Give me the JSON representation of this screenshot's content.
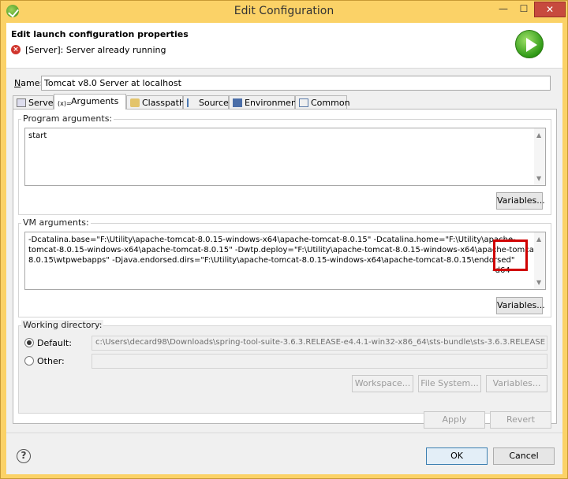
{
  "window": {
    "title": "Edit Configuration",
    "controls": {
      "minimize": "—",
      "maximize": "☐",
      "close": "✕"
    }
  },
  "header": {
    "title": "Edit launch configuration properties",
    "message": "[Server]: Server already running",
    "error_icon": "error-icon",
    "run_icon": "run-icon"
  },
  "name_field": {
    "label": "Name:",
    "value": "Tomcat v8.0 Server at localhost"
  },
  "tabs": [
    {
      "label": "Server",
      "icon": "server-icon"
    },
    {
      "label": "Arguments",
      "icon": "arguments-icon",
      "active": true
    },
    {
      "label": "Classpath",
      "icon": "classpath-icon"
    },
    {
      "label": "Source",
      "icon": "source-icon"
    },
    {
      "label": "Environment",
      "icon": "environment-icon"
    },
    {
      "label": "Common",
      "icon": "common-icon"
    }
  ],
  "program_arguments": {
    "label": "Program arguments:",
    "value": "start",
    "variables_button": "Variables..."
  },
  "vm_arguments": {
    "label": "VM arguments:",
    "lines": [
      "-Dcatalina.base=\"F:\\Utility\\apache-tomcat-8.0.15-windows-x64\\apache-tomcat-8.0.15\" -Dcatalina.home=\"F:\\Utility\\apache-",
      "tomcat-8.0.15-windows-x64\\apache-tomcat-8.0.15\" -Dwtp.deploy=\"F:\\Utility\\apache-tomcat-8.0.15-windows-x64\\apache-tomcat-",
      "8.0.15\\wtpwebapps\" -Djava.endorsed.dirs=\"F:\\Utility\\apache-tomcat-8.0.15-windows-x64\\apache-tomcat-8.0.15\\endorsed\"",
      "-d64"
    ],
    "variables_button": "Variables..."
  },
  "working_directory": {
    "label": "Working directory:",
    "default_label": "Default:",
    "default_value": "c:\\Users\\decard98\\Downloads\\spring-tool-suite-3.6.3.RELEASE-e4.4.1-win32-x86_64\\sts-bundle\\sts-3.6.3.RELEASE",
    "other_label": "Other:",
    "other_value": "",
    "workspace_button": "Workspace...",
    "filesystem_button": "File System...",
    "variables_button": "Variables..."
  },
  "actions": {
    "apply": "Apply",
    "revert": "Revert"
  },
  "footer": {
    "help": "?",
    "ok": "OK",
    "cancel": "Cancel"
  },
  "colors": {
    "title_bar": "#fbd267",
    "highlight": "#d00000",
    "close_button": "#c74a3e"
  }
}
